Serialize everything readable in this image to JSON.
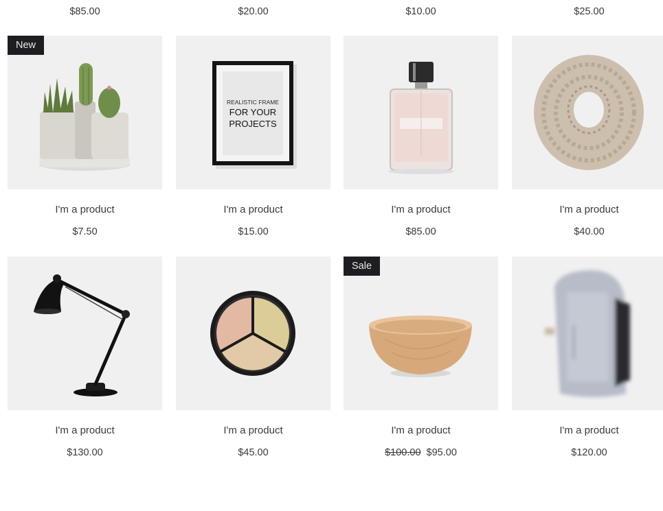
{
  "top_row_prices": [
    "$85.00",
    "$20.00",
    "$10.00",
    "$25.00"
  ],
  "products": [
    {
      "id": "cactus",
      "name": "I'm a product",
      "price": "$7.50",
      "ribbon": "New",
      "icon": "cactus-pot-icon"
    },
    {
      "id": "frame",
      "name": "I'm a product",
      "price": "$15.00",
      "ribbon": "",
      "icon": "picture-frame-icon",
      "frame_text": {
        "line1": "REALISTIC FRAME",
        "line2": "FOR YOUR",
        "line3": "PROJECTS"
      }
    },
    {
      "id": "perfume",
      "name": "I'm a product",
      "price": "$85.00",
      "ribbon": "",
      "icon": "perfume-bottle-icon"
    },
    {
      "id": "scarf",
      "name": "I'm a product",
      "price": "$40.00",
      "ribbon": "",
      "icon": "knit-scarf-icon"
    },
    {
      "id": "lamp",
      "name": "I'm a product",
      "price": "$130.00",
      "ribbon": "",
      "icon": "desk-lamp-icon"
    },
    {
      "id": "palette",
      "name": "I'm a product",
      "price": "$45.00",
      "ribbon": "",
      "icon": "concealer-palette-icon"
    },
    {
      "id": "bowl",
      "name": "I'm a product",
      "price": "$95.00",
      "old_price": "$100.00",
      "ribbon": "Sale",
      "icon": "wooden-bowl-icon"
    },
    {
      "id": "backpack",
      "name": "I'm a product",
      "price": "$120.00",
      "ribbon": "",
      "icon": "backpack-icon"
    }
  ],
  "colors": {
    "ribbon_bg": "#1e1e22",
    "image_bg": "#f0f0f0",
    "text": "#3a3a3a"
  }
}
